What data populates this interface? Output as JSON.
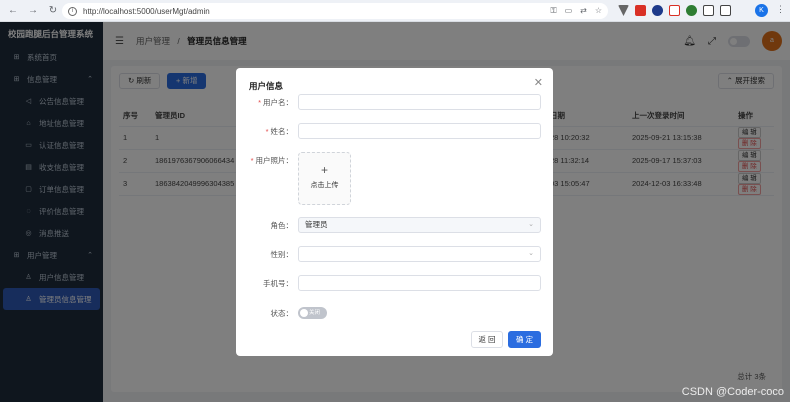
{
  "browser": {
    "url": "http://localhost:5000/userMgt/admin",
    "profile_initial": "K"
  },
  "app": {
    "title": "校园跑腿后台管理系统"
  },
  "sidebar": {
    "items": [
      {
        "label": "系统首页",
        "icon": "grid-icon"
      },
      {
        "label": "信息管理",
        "icon": "grid-icon",
        "group": true
      },
      {
        "label": "公告信息管理",
        "icon": "megaphone-icon"
      },
      {
        "label": "地址信息管理",
        "icon": "home-icon"
      },
      {
        "label": "认证信息管理",
        "icon": "id-card-icon"
      },
      {
        "label": "收支信息管理",
        "icon": "wallet-icon"
      },
      {
        "label": "订单信息管理",
        "icon": "order-icon"
      },
      {
        "label": "评价信息管理",
        "icon": "comment-icon"
      },
      {
        "label": "消息推送",
        "icon": "message-icon"
      },
      {
        "label": "用户管理",
        "icon": "grid-icon",
        "group": true
      },
      {
        "label": "用户信息管理",
        "icon": "user-icon"
      },
      {
        "label": "管理员信息管理",
        "icon": "user-icon",
        "active": true
      }
    ]
  },
  "header": {
    "breadcrumb_parent": "用户管理",
    "breadcrumb_separator": "/",
    "breadcrumb_current": "管理员信息管理",
    "avatar_text": "a"
  },
  "toolbar": {
    "refresh_label": "刷新",
    "add_label": "+ 新增",
    "expand_search_label": "展开搜索"
  },
  "table": {
    "columns": [
      "序号",
      "管理员ID",
      "日期",
      "上一次登录时间",
      "操作"
    ],
    "rows": [
      {
        "index": "1",
        "id": "1",
        "date": "28 10:20:32",
        "last_login": "2025-09-21 13:15:38"
      },
      {
        "index": "2",
        "id": "1861976367906066434",
        "date": "28 11:32:14",
        "last_login": "2025-09-17 15:37:03"
      },
      {
        "index": "3",
        "id": "1863842049996304385",
        "date": "03 15:05:47",
        "last_login": "2024-12-03 16:33:48"
      }
    ],
    "edit_label": "编 辑",
    "delete_label": "删 除"
  },
  "pagination": {
    "total_label": "总计 3条"
  },
  "watermark": "CSDN @Coder-coco",
  "dialog": {
    "title": "用户信息",
    "username_label": "用户名：",
    "username_value": "",
    "name_label": "姓名：",
    "name_value": "",
    "photo_label": "用户照片：",
    "upload_plus": "+",
    "upload_text": "点击上传",
    "role_label": "角色：",
    "role_value": "管理员",
    "gender_label": "性别：",
    "gender_value": "",
    "phone_label": "手机号：",
    "phone_value": "",
    "status_label": "状态：",
    "status_value": "关闭",
    "cancel_label": "返 回",
    "confirm_label": "确 定"
  },
  "colors": {
    "sidebar_bg": "#1f2d3d",
    "primary": "#2b6de0",
    "danger": "#e04848",
    "avatar": "#e0701b"
  }
}
